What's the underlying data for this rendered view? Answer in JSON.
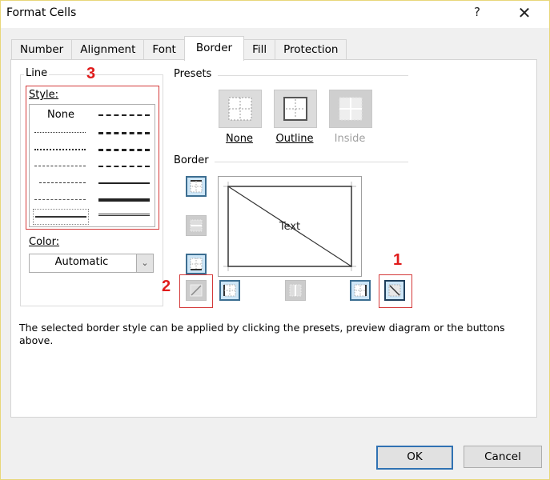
{
  "window": {
    "title": "Format Cells",
    "help_label": "?",
    "close_label": "✕"
  },
  "tabs": [
    {
      "label": "Number",
      "active": false
    },
    {
      "label": "Alignment",
      "active": false
    },
    {
      "label": "Font",
      "active": false
    },
    {
      "label": "Border",
      "active": true
    },
    {
      "label": "Fill",
      "active": false
    },
    {
      "label": "Protection",
      "active": false
    }
  ],
  "line": {
    "group_label": "Line",
    "style_label": "Style:",
    "style_none_label": "None",
    "selected_style": "thin-double-bottom-left",
    "color_label": "Color:",
    "color_value": "Automatic"
  },
  "presets": {
    "section_label": "Presets",
    "items": [
      {
        "label": "None",
        "enabled": true
      },
      {
        "label": "Outline",
        "enabled": true
      },
      {
        "label": "Inside",
        "enabled": false
      }
    ]
  },
  "border": {
    "section_label": "Border",
    "preview_text": "Text",
    "buttons": {
      "top": "on",
      "inside_horizontal": "off",
      "bottom": "on",
      "diagonal_up": "off",
      "left": "on",
      "inside_vertical": "off",
      "right": "on",
      "diagonal_down": "on"
    }
  },
  "annotations": {
    "one": "1",
    "two": "2",
    "three": "3",
    "color": "#e01b1b"
  },
  "description": "The selected border style can be applied by clicking the presets, preview diagram or the buttons above.",
  "footer": {
    "ok_label": "OK",
    "cancel_label": "Cancel"
  },
  "colors": {
    "accent": "#3072b3",
    "border_button_on": "#cde6f7",
    "annotation_red": "#e01b1b"
  }
}
